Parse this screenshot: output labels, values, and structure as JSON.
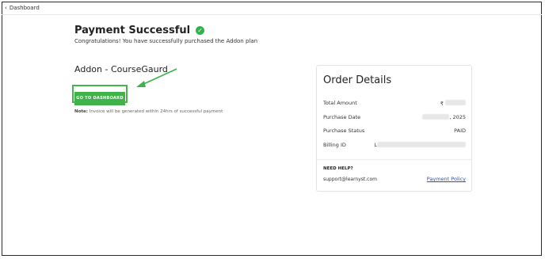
{
  "nav": {
    "back_label": "Dashboard",
    "back_icon": "chevron-left-icon"
  },
  "status": {
    "title": "Payment Successful",
    "icon": "check-circle-icon",
    "accent": "#2fb34a",
    "message": "Congratulations! You have successfully purchased the Addon plan"
  },
  "plan": {
    "name": "Addon - CourseGaurd"
  },
  "actions": {
    "dashboard_button": "GO TO DASHBOARD"
  },
  "note": {
    "label": "Note:",
    "text": " Invoice will be generated within 24hrs of successful payment"
  },
  "order": {
    "title": "Order Details",
    "rows": [
      {
        "label": "Total Amount",
        "value": "₹"
      },
      {
        "label": "Purchase Date",
        "value": ", 2025"
      },
      {
        "label": "Purchase Status",
        "value": "PAID"
      },
      {
        "label": "Billing ID",
        "value": "L"
      }
    ]
  },
  "help": {
    "heading": "NEED HELP?",
    "email": "support@learnyst.com",
    "policy_link": "Payment Policy"
  }
}
